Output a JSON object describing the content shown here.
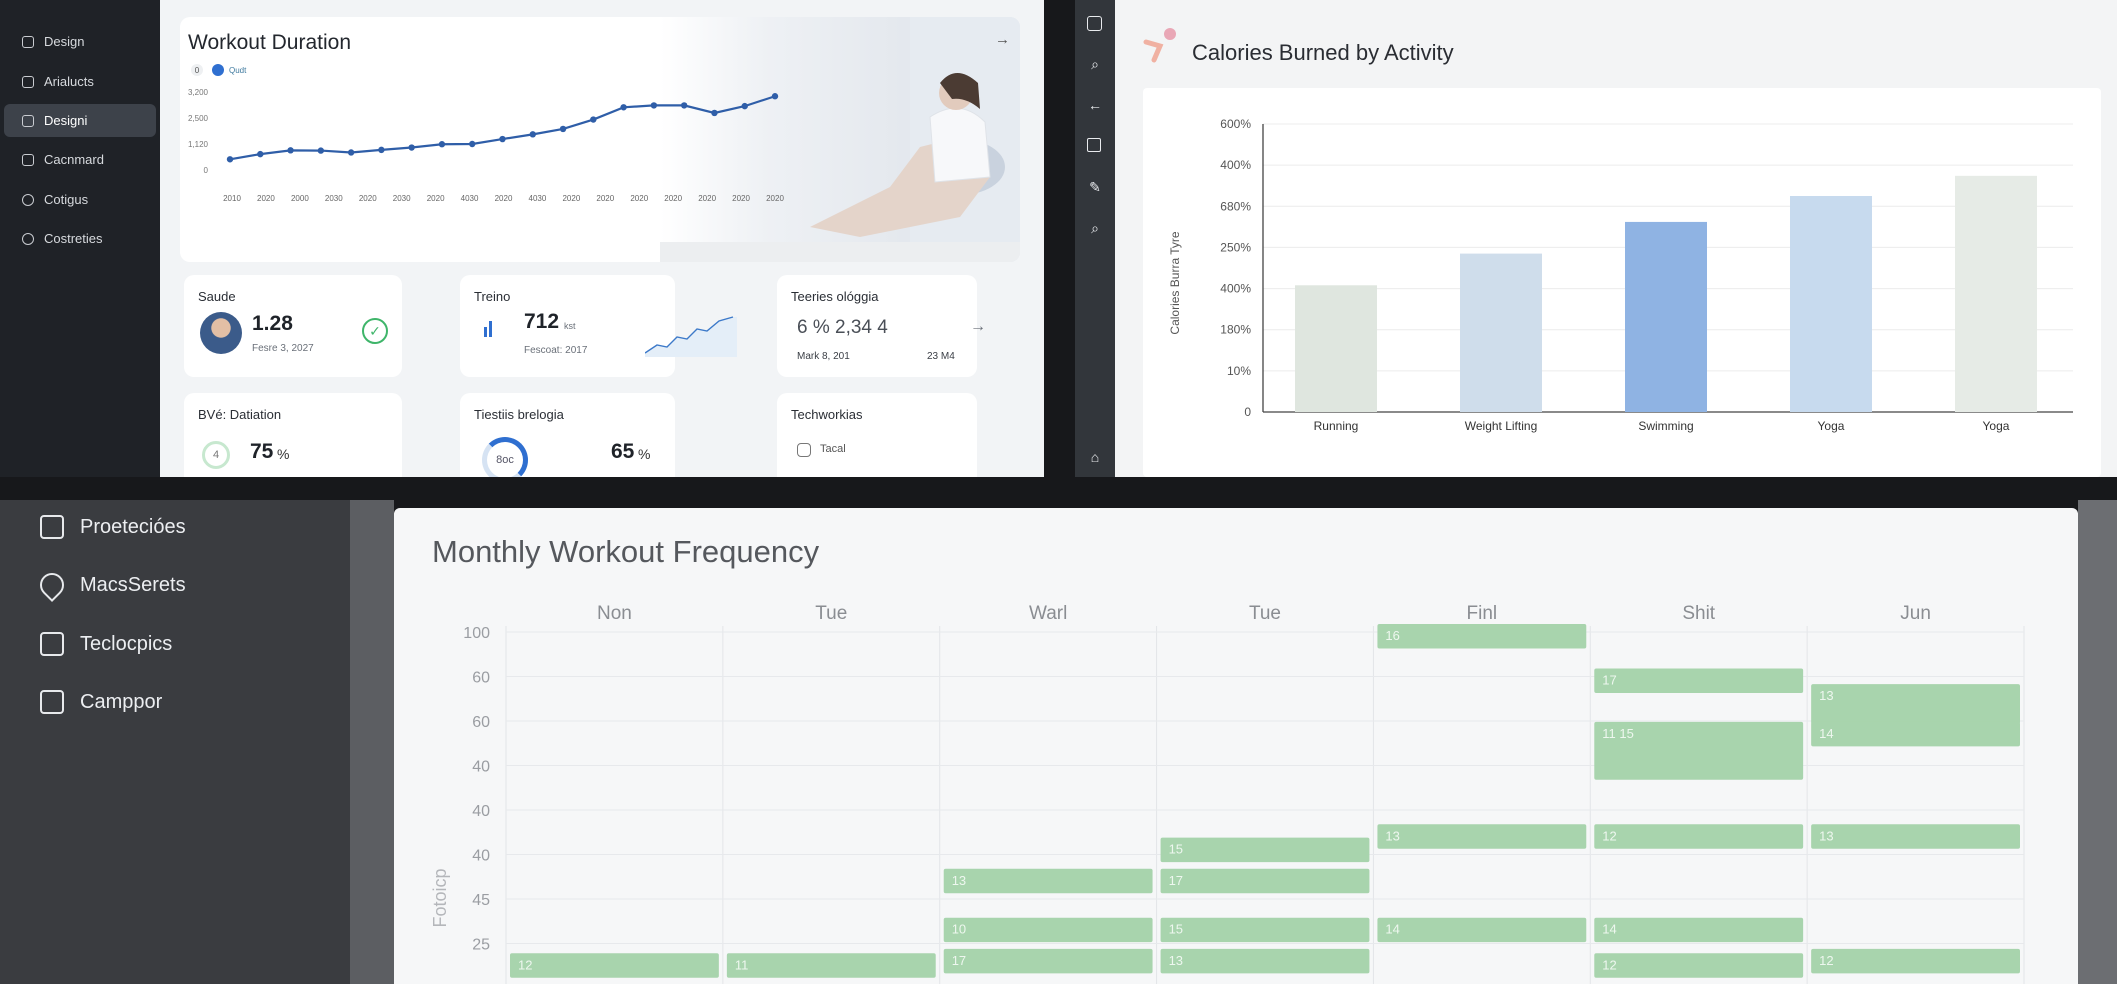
{
  "panel1": {
    "sidebar": {
      "items": [
        {
          "label": "Design",
          "icon": "chart-icon"
        },
        {
          "label": "Arialucts",
          "icon": "home-icon"
        },
        {
          "label": "Designi",
          "icon": "gear-icon",
          "active": true
        },
        {
          "label": "Cacnmard",
          "icon": "card-icon"
        },
        {
          "label": "Cotigus",
          "icon": "circle-icon"
        },
        {
          "label": "Costreties",
          "icon": "power-icon"
        }
      ]
    },
    "workout": {
      "title": "Workout Duration",
      "arrow": "→",
      "legend_a": "0",
      "legend_b": "Qudt",
      "chart_data": {
        "type": "line",
        "ytick_labels": [
          "3,200",
          "2,500",
          "1,120",
          "0"
        ],
        "xtick_labels": [
          "2010",
          "2020",
          "2000",
          "2030",
          "2020",
          "2030",
          "2020",
          "4030",
          "2020",
          "4030",
          "2020",
          "2020",
          "2020",
          "2020",
          "2020",
          "2020",
          "2020"
        ],
        "values": [
          540,
          760,
          920,
          910,
          830,
          940,
          1040,
          1180,
          1190,
          1400,
          1600,
          1830,
          2230,
          2750,
          2830,
          2830,
          2510,
          2800,
          3220
        ],
        "ylim": [
          0,
          3400
        ],
        "color": "#2f5ea8"
      }
    },
    "cards": {
      "saude": {
        "title": "Saude",
        "value": "1.28",
        "sub": "Fesre 3, 2027",
        "check_color": "#3fb56a"
      },
      "treino": {
        "title": "Treino",
        "value": "712",
        "unit": "kst",
        "sub": "Fescoat: 2017"
      },
      "teeries": {
        "title": "Teeries ológgia",
        "value": "6 % 2,34 4",
        "sub": "Mark 8, 201",
        "delta": "23 M4",
        "delta_arrow": "→"
      },
      "bve": {
        "title": "BVé: Datiation",
        "ring_value": "4",
        "value": "75",
        "unit": "%"
      },
      "testis": {
        "title": "Tiestiis brelogia",
        "ring_value": "8oc",
        "value": "65",
        "unit": "%"
      },
      "techworkias": {
        "title": "Techworkias",
        "item": "Tacal"
      }
    }
  },
  "panel2": {
    "rail_icons": [
      "chart-icon",
      "search-icon",
      "back-arrow-icon",
      "copy-icon",
      "edit-icon",
      "zoom-icon",
      "home-icon"
    ],
    "logo": "runner-logo-icon",
    "title": "Calories Burned by Activity",
    "chart_data": {
      "type": "bar",
      "ylabel": "Calories Burra Tyre",
      "ytick_labels": [
        "600%",
        "400%",
        "680%",
        "250%",
        "400%",
        "180%",
        "10%",
        "0"
      ],
      "categories": [
        "Running",
        "Weight Lifting",
        "Swimming",
        "Yoga",
        "Yoga"
      ],
      "values": [
        0.44,
        0.55,
        0.66,
        0.75,
        0.82
      ],
      "value_scale": "fraction of plot height",
      "colors": [
        "#dfe6df",
        "#cfddeb",
        "#8fb3e3",
        "#c7daee",
        "#e6ebe6"
      ]
    }
  },
  "panel3": {
    "sidebar": {
      "items": [
        {
          "label": "Proetecióes",
          "icon": "grid-icon"
        },
        {
          "label": "MacsSerets",
          "icon": "location-pin-icon"
        },
        {
          "label": "Teclocpics",
          "icon": "building-icon"
        },
        {
          "label": "Camppor",
          "icon": "monitor-icon"
        }
      ]
    },
    "title": "Monthly Workout Frequency",
    "chart_data": {
      "type": "table",
      "ylabel": "Fotoicp",
      "columns": [
        "Non",
        "Tue",
        "Warl",
        "Tue",
        "Finl",
        "Shit",
        "Jun"
      ],
      "row_labels": [
        "100",
        "60",
        "60",
        "40",
        "40",
        "40",
        "45",
        "25"
      ],
      "events": [
        {
          "col": 4,
          "row": 0,
          "label": "16"
        },
        {
          "col": 5,
          "row": 1,
          "label": "17"
        },
        {
          "col": 6,
          "row": 1.35,
          "label": "13",
          "span": 0.9
        },
        {
          "col": 6,
          "row": 2.2,
          "label": "14"
        },
        {
          "col": 5,
          "row": 2.2,
          "label": "11  15",
          "span": 1.3
        },
        {
          "col": 4,
          "row": 4.5,
          "label": "13"
        },
        {
          "col": 5,
          "row": 4.5,
          "label": "12"
        },
        {
          "col": 6,
          "row": 4.5,
          "label": "13"
        },
        {
          "col": 3,
          "row": 4.8,
          "label": "15"
        },
        {
          "col": 2,
          "row": 5.5,
          "label": "13"
        },
        {
          "col": 3,
          "row": 5.5,
          "label": "17"
        },
        {
          "col": 2,
          "row": 6.6,
          "label": "10"
        },
        {
          "col": 3,
          "row": 6.6,
          "label": "15"
        },
        {
          "col": 4,
          "row": 6.6,
          "label": "14"
        },
        {
          "col": 5,
          "row": 6.6,
          "label": "14"
        },
        {
          "col": 2,
          "row": 7.3,
          "label": "17"
        },
        {
          "col": 3,
          "row": 7.3,
          "label": "13"
        },
        {
          "col": 0,
          "row": 7.4,
          "label": "12"
        },
        {
          "col": 1,
          "row": 7.4,
          "label": "11"
        },
        {
          "col": 5,
          "row": 7.4,
          "label": "12"
        },
        {
          "col": 6,
          "row": 7.3,
          "label": "12"
        }
      ],
      "event_color": "#a8d4ad"
    }
  }
}
